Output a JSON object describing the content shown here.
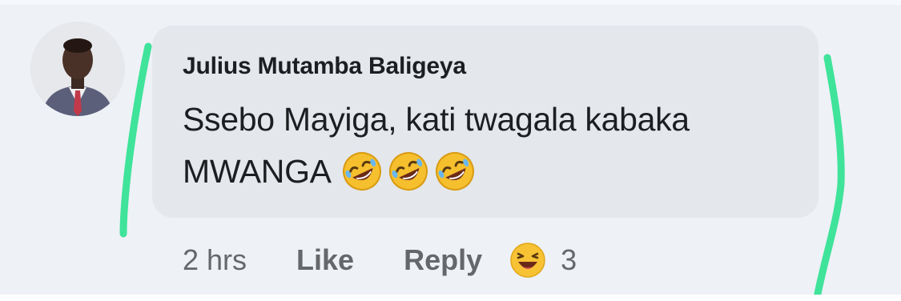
{
  "comment": {
    "author": "Julius Mutamba Baligeya",
    "text_line1": "Ssebo Mayiga, kati twagala kabaka",
    "text_line2": "MWANGA",
    "inline_emojis": [
      "rolling-on-floor-laughing",
      "rolling-on-floor-laughing",
      "rolling-on-floor-laughing"
    ]
  },
  "actions": {
    "timestamp": "2 hrs",
    "like_label": "Like",
    "reply_label": "Reply",
    "reaction_icon": "haha-reaction",
    "reaction_count": "3"
  },
  "colors": {
    "bubble": "#e4e7eb",
    "page_bg": "#eef1f6",
    "text": "#1c1e21",
    "meta_text": "#65676b",
    "highlight_mark": "#3fe39a",
    "emoji_yellow": "#f7c234"
  }
}
